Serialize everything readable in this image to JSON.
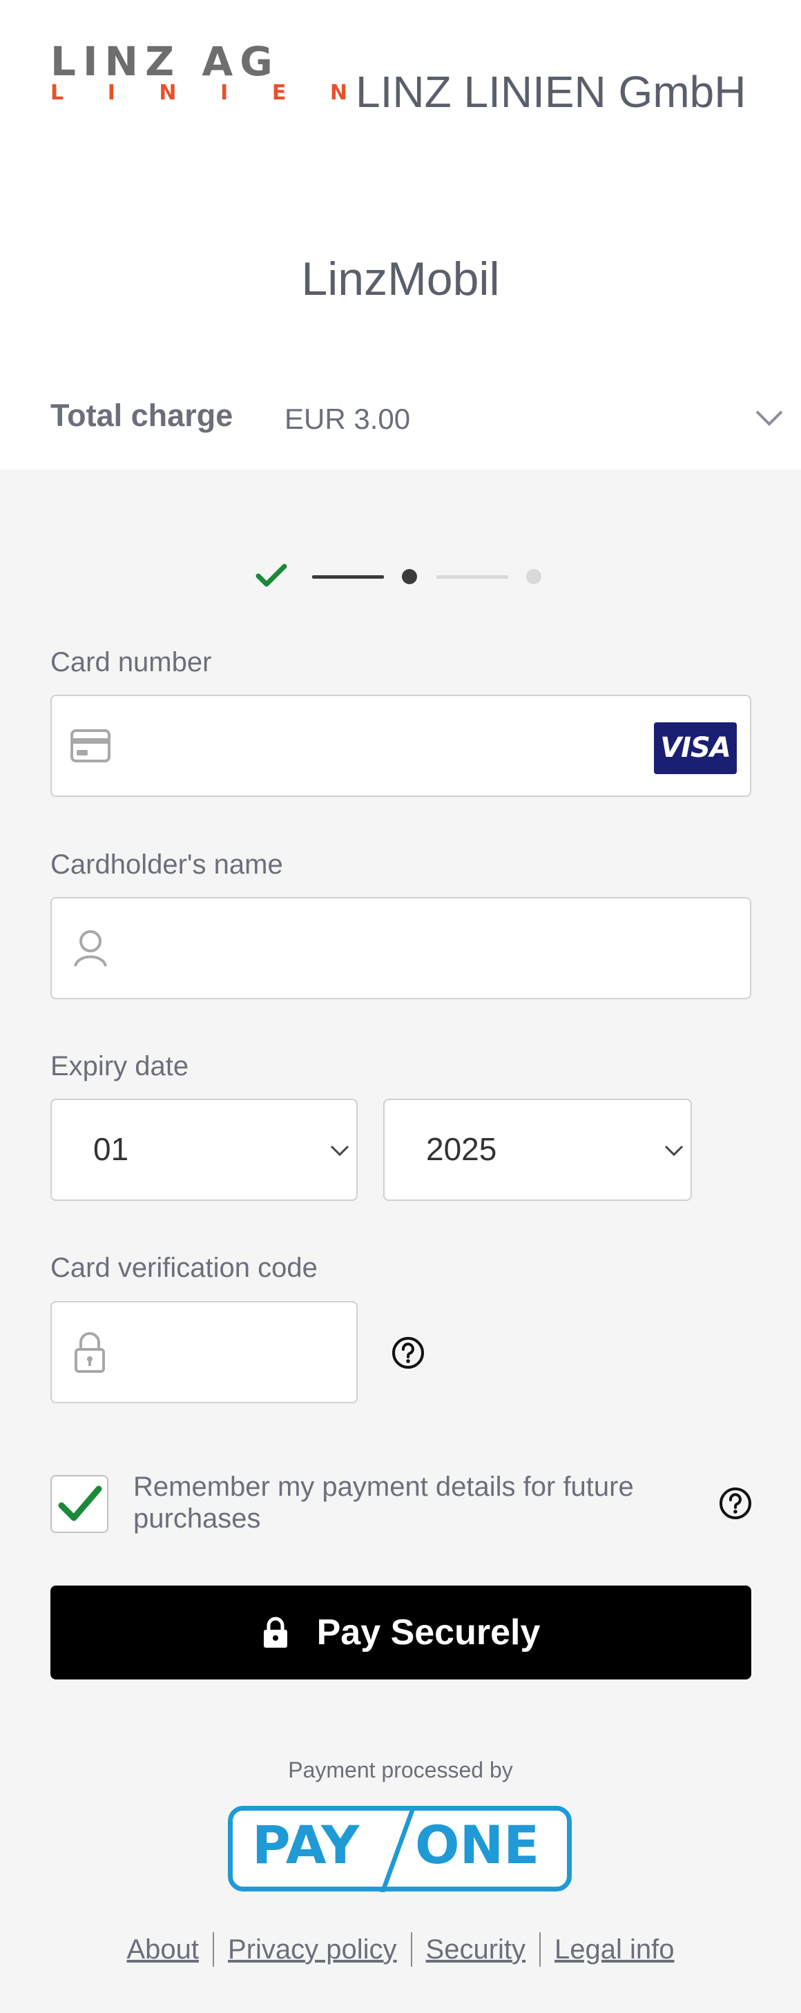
{
  "header": {
    "logo_word": "LINZ AG",
    "logo_sub": [
      "L",
      "I",
      "N",
      "I",
      "E",
      "N"
    ],
    "merchant_name": "LINZ LINIEN GmbH",
    "product_name": "LinzMobil",
    "total_label": "Total charge",
    "total_value": "EUR 3.00"
  },
  "progress": {
    "current_step": 2,
    "total_steps": 3
  },
  "form": {
    "card_number": {
      "label": "Card number",
      "value": "",
      "icon": "credit-card-icon",
      "brand": "VISA"
    },
    "cardholder": {
      "label": "Cardholder's name",
      "value": "",
      "icon": "user-icon"
    },
    "expiry": {
      "label": "Expiry date",
      "month": "01",
      "year": "2025"
    },
    "cvc": {
      "label": "Card verification code",
      "value": "",
      "icon": "lock-icon"
    },
    "remember": {
      "label": "Remember my payment details for future purchases",
      "checked": true
    },
    "submit_label": "Pay Securely"
  },
  "footer": {
    "processed_by": "Payment processed by",
    "provider_left": "PAY",
    "provider_right": "ONE",
    "links": [
      "About",
      "Privacy policy",
      "Security",
      "Legal info"
    ]
  },
  "colors": {
    "brand_orange": "#e8512b",
    "visa_blue": "#1a1f71",
    "payone_blue": "#1f9ad6",
    "check_green": "#1a8a3a",
    "button_black": "#000000"
  }
}
